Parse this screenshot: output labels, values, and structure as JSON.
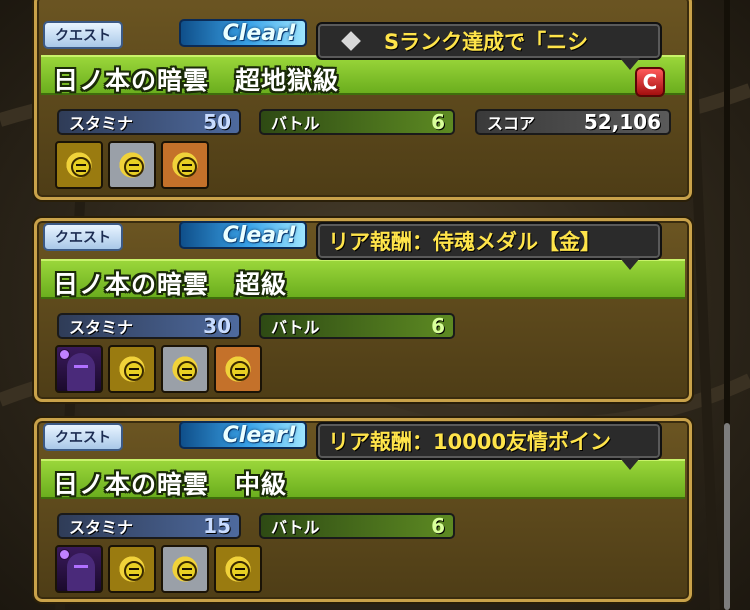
{
  "quests": [
    {
      "quest_label": "クエスト",
      "clear_label": "Clear!",
      "title": "日ノ本の暗雲　超地獄級",
      "tooltip": "Sランク達成で「ニシ",
      "rank_badge": "C",
      "stamina_label": "スタミナ",
      "stamina": "50",
      "battle_label": "バトル",
      "battle": "6",
      "score_label": "スコア",
      "score": "52,106",
      "monsters": [
        "gold-medal-icon",
        "silver-medal-icon",
        "bronze-medal-icon"
      ]
    },
    {
      "quest_label": "クエスト",
      "clear_label": "Clear!",
      "title": "日ノ本の暗雲　超級",
      "tooltip": "リア報酬：侍魂メダル【金】",
      "stamina_label": "スタミナ",
      "stamina": "30",
      "battle_label": "バトル",
      "battle": "6",
      "monsters": [
        "ninja-monster-icon",
        "gold-medal-icon",
        "silver-medal-icon",
        "bronze-medal-icon"
      ]
    },
    {
      "quest_label": "クエスト",
      "clear_label": "Clear!",
      "title": "日ノ本の暗雲　中級",
      "tooltip": "リア報酬：10000友情ポイン",
      "stamina_label": "スタミナ",
      "stamina": "15",
      "battle_label": "バトル",
      "battle": "6",
      "monsters": [
        "ninja-monster-icon",
        "gold-medal-icon",
        "silver-medal-icon",
        "gold-medal-icon"
      ]
    }
  ],
  "colors": {
    "card_border": "#c9a24a",
    "title_green": "#8acb2e",
    "tooltip_text": "#ffe44a",
    "clear_blue": "#3aa3e8"
  }
}
